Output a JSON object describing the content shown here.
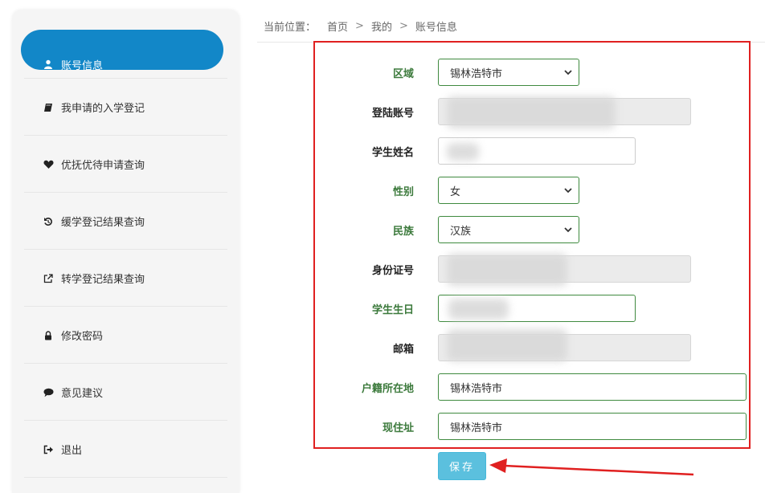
{
  "breadcrumb": {
    "prefix": "当前位置：",
    "home": "首页",
    "sep1": ">",
    "mine": "我的",
    "sep2": ">",
    "current": "账号信息"
  },
  "sidebar": {
    "items": [
      {
        "label": "账号信息",
        "icon": "user-icon"
      },
      {
        "label": "我申请的入学登记",
        "icon": "book-icon"
      },
      {
        "label": "优抚优待申请查询",
        "icon": "heart-icon"
      },
      {
        "label": "缓学登记结果查询",
        "icon": "undo-icon"
      },
      {
        "label": "转学登记结果查询",
        "icon": "external-link-icon"
      },
      {
        "label": "修改密码",
        "icon": "lock-icon"
      },
      {
        "label": "意见建议",
        "icon": "comment-icon"
      },
      {
        "label": "退出",
        "icon": "sign-out-icon"
      }
    ]
  },
  "form": {
    "region_label": "区域",
    "region_value": "锡林浩特市",
    "account_label": "登陆账号",
    "account_value": "",
    "name_label": "学生姓名",
    "name_value": "",
    "gender_label": "性别",
    "gender_value": "女",
    "ethnicity_label": "民族",
    "ethnicity_value": "汉族",
    "id_label": "身份证号",
    "id_value": "",
    "birthday_label": "学生生日",
    "birthday_value": "",
    "email_label": "邮箱",
    "email_value": "",
    "hukou_label": "户籍所在地",
    "hukou_value": "锡林浩特市",
    "address_label": "现住址",
    "address_value": "锡林浩特市"
  },
  "save_label": "保存",
  "colors": {
    "accent": "#1287c8",
    "highlight_border": "#e02020",
    "save_button": "#5bc0de",
    "green_label": "#3c7a3c"
  }
}
